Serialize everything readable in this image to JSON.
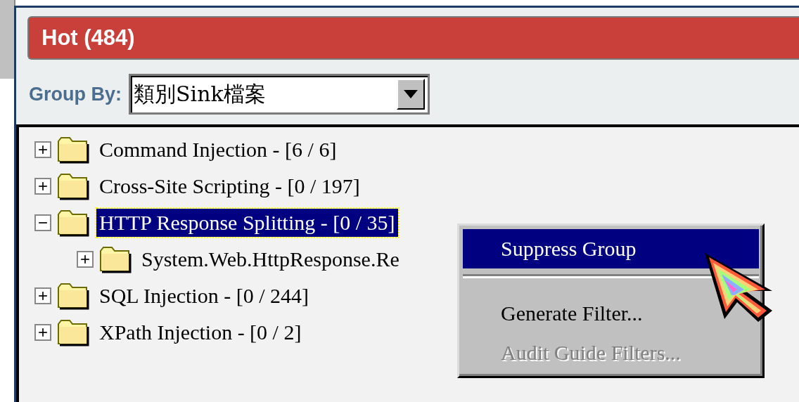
{
  "panel": {
    "title": "Hot (484)"
  },
  "group_by": {
    "label": "Group By:",
    "value": "類別Sink檔案"
  },
  "tree": [
    {
      "label": "Command Injection - [6 / 6]",
      "expanded": false,
      "selected": false
    },
    {
      "label": "Cross-Site Scripting - [0 / 197]",
      "expanded": false,
      "selected": false
    },
    {
      "label": "HTTP Response Splitting - [0 / 35]",
      "expanded": true,
      "selected": true,
      "children": [
        {
          "label": "System.Web.HttpResponse.Re",
          "expanded": false,
          "selected": false
        }
      ]
    },
    {
      "label": "SQL Injection - [0 / 244]",
      "expanded": false,
      "selected": false
    },
    {
      "label": "XPath Injection - [0 / 2]",
      "expanded": false,
      "selected": false
    }
  ],
  "context_menu": [
    {
      "kind": "item",
      "label": "Suppress Group",
      "selected": true,
      "disabled": false
    },
    {
      "kind": "separator"
    },
    {
      "kind": "item",
      "label": "Generate Filter...",
      "selected": false,
      "disabled": false
    },
    {
      "kind": "item",
      "label": "Audit Guide Filters...",
      "selected": false,
      "disabled": true
    }
  ]
}
